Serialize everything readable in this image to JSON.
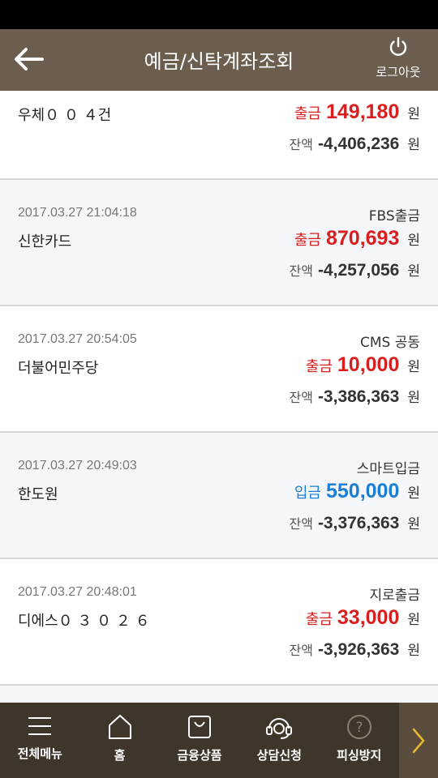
{
  "header": {
    "title": "예금/신탁계좌조회",
    "logout_label": "로그아웃"
  },
  "transactions": [
    {
      "date": "",
      "type": "",
      "payee": "우체０ ０ ４건",
      "kind": "출금",
      "kind_class": "out",
      "amount": "149,180",
      "won": "원",
      "balance_label": "잔액",
      "balance": "-4,406,236",
      "balance_won": "원"
    },
    {
      "date": "2017.03.27 21:04:18",
      "type": "FBS출금",
      "payee": "신한카드",
      "kind": "출금",
      "kind_class": "out",
      "amount": "870,693",
      "won": "원",
      "balance_label": "잔액",
      "balance": "-4,257,056",
      "balance_won": "원"
    },
    {
      "date": "2017.03.27 20:54:05",
      "type": "CMS 공동",
      "payee": "더불어민주당",
      "kind": "출금",
      "kind_class": "out",
      "amount": "10,000",
      "won": "원",
      "balance_label": "잔액",
      "balance": "-3,386,363",
      "balance_won": "원"
    },
    {
      "date": "2017.03.27 20:49:03",
      "type": "스마트입금",
      "payee": "한도원",
      "kind": "입금",
      "kind_class": "in",
      "amount": "550,000",
      "won": "원",
      "balance_label": "잔액",
      "balance": "-3,376,363",
      "balance_won": "원"
    },
    {
      "date": "2017.03.27 20:48:01",
      "type": "지로출금",
      "payee": "디에스０ ３ ０ ２ ６",
      "kind": "출금",
      "kind_class": "out",
      "amount": "33,000",
      "won": "원",
      "balance_label": "잔액",
      "balance": "-3,926,363",
      "balance_won": "원"
    }
  ],
  "bottom_nav": [
    {
      "label": "전체메뉴",
      "icon": "menu-icon"
    },
    {
      "label": "홈",
      "icon": "home-icon"
    },
    {
      "label": "금융상품",
      "icon": "shopping-bag-icon"
    },
    {
      "label": "상담신청",
      "icon": "headset-icon"
    },
    {
      "label": "피싱방지",
      "icon": "question-icon"
    }
  ],
  "colors": {
    "header_bg": "#6b5e4e",
    "nav_bg": "#3f362b",
    "withdraw": "#d81e1e",
    "deposit": "#1a7ed6"
  }
}
